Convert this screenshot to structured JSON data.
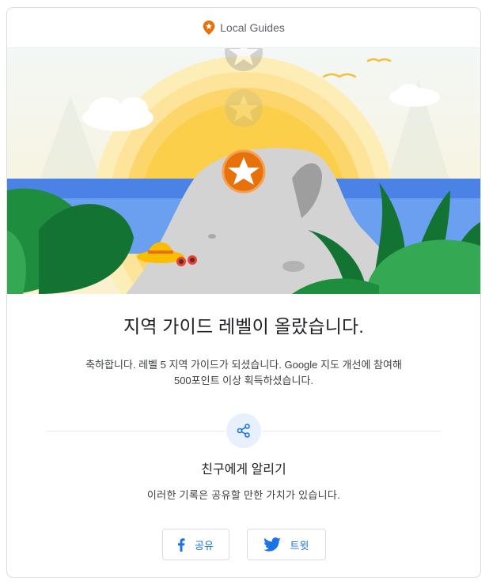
{
  "header": {
    "brand_name": "Local Guides",
    "icon": "local-guides-pin-icon",
    "brand_color": "#e8710a"
  },
  "hero": {
    "illustration": "level-up-beach-illustration",
    "sky_color": "#fdf2c6",
    "sun_color": "#fbcf4a",
    "water_color": "#4a82e6",
    "badge_color": "#e8710a"
  },
  "main": {
    "title": "지역 가이드 레벨이 올랐습니다.",
    "description_line1": "축하합니다. 레벨 5 지역 가이드가 되셨습니다. Google 지도 개선에 참여해",
    "description_line2": "500포인트 이상 획득하셨습니다."
  },
  "share": {
    "icon": "share-icon",
    "title": "친구에게 알리기",
    "subtitle": "이러한 기록은 공유할 만한 가치가 있습니다.",
    "buttons": [
      {
        "icon": "facebook-icon",
        "label": "공유"
      },
      {
        "icon": "twitter-icon",
        "label": "트윗"
      }
    ],
    "accent_color": "#1a73e8"
  }
}
